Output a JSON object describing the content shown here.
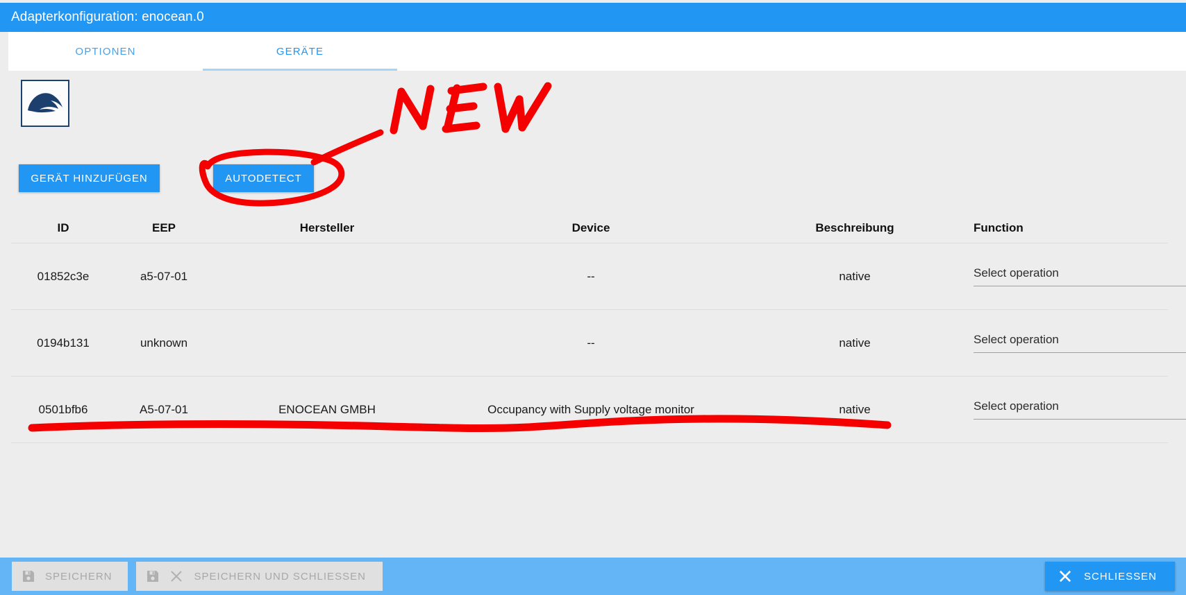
{
  "window": {
    "title": "Adapterkonfiguration: enocean.0"
  },
  "tabs": [
    {
      "label": "OPTIONEN",
      "active": false
    },
    {
      "label": "GERÄTE",
      "active": true
    }
  ],
  "logo": {
    "name": "dolphin-logo"
  },
  "actions": {
    "add_device": "GERÄT HINZUFÜGEN",
    "autodetect": "AUTODETECT"
  },
  "table": {
    "columns": [
      "ID",
      "EEP",
      "Hersteller",
      "Device",
      "Beschreibung",
      "Function"
    ],
    "rows": [
      {
        "id": "01852c3e",
        "eep": "a5-07-01",
        "hersteller": "",
        "device": "--",
        "beschreibung": "native",
        "function": "Select operation"
      },
      {
        "id": "0194b131",
        "eep": "unknown",
        "hersteller": "",
        "device": "--",
        "beschreibung": "native",
        "function": "Select operation"
      },
      {
        "id": "0501bfb6",
        "eep": "A5-07-01",
        "hersteller": "ENOCEAN GMBH",
        "device": "Occupancy with Supply voltage monitor",
        "beschreibung": "native",
        "function": "Select operation"
      }
    ]
  },
  "footer": {
    "save": "SPEICHERN",
    "save_and_close": "SPEICHERN UND SCHLIESSEN",
    "close": "SCHLIESSEN"
  },
  "annotations": {
    "new_label": "NEW",
    "color": "#f50000"
  },
  "colors": {
    "titlebar": "#2196f3",
    "footer": "#64b5f6",
    "accent": "#2196f3",
    "background": "#ededed",
    "logo": "#1d3f6e"
  }
}
